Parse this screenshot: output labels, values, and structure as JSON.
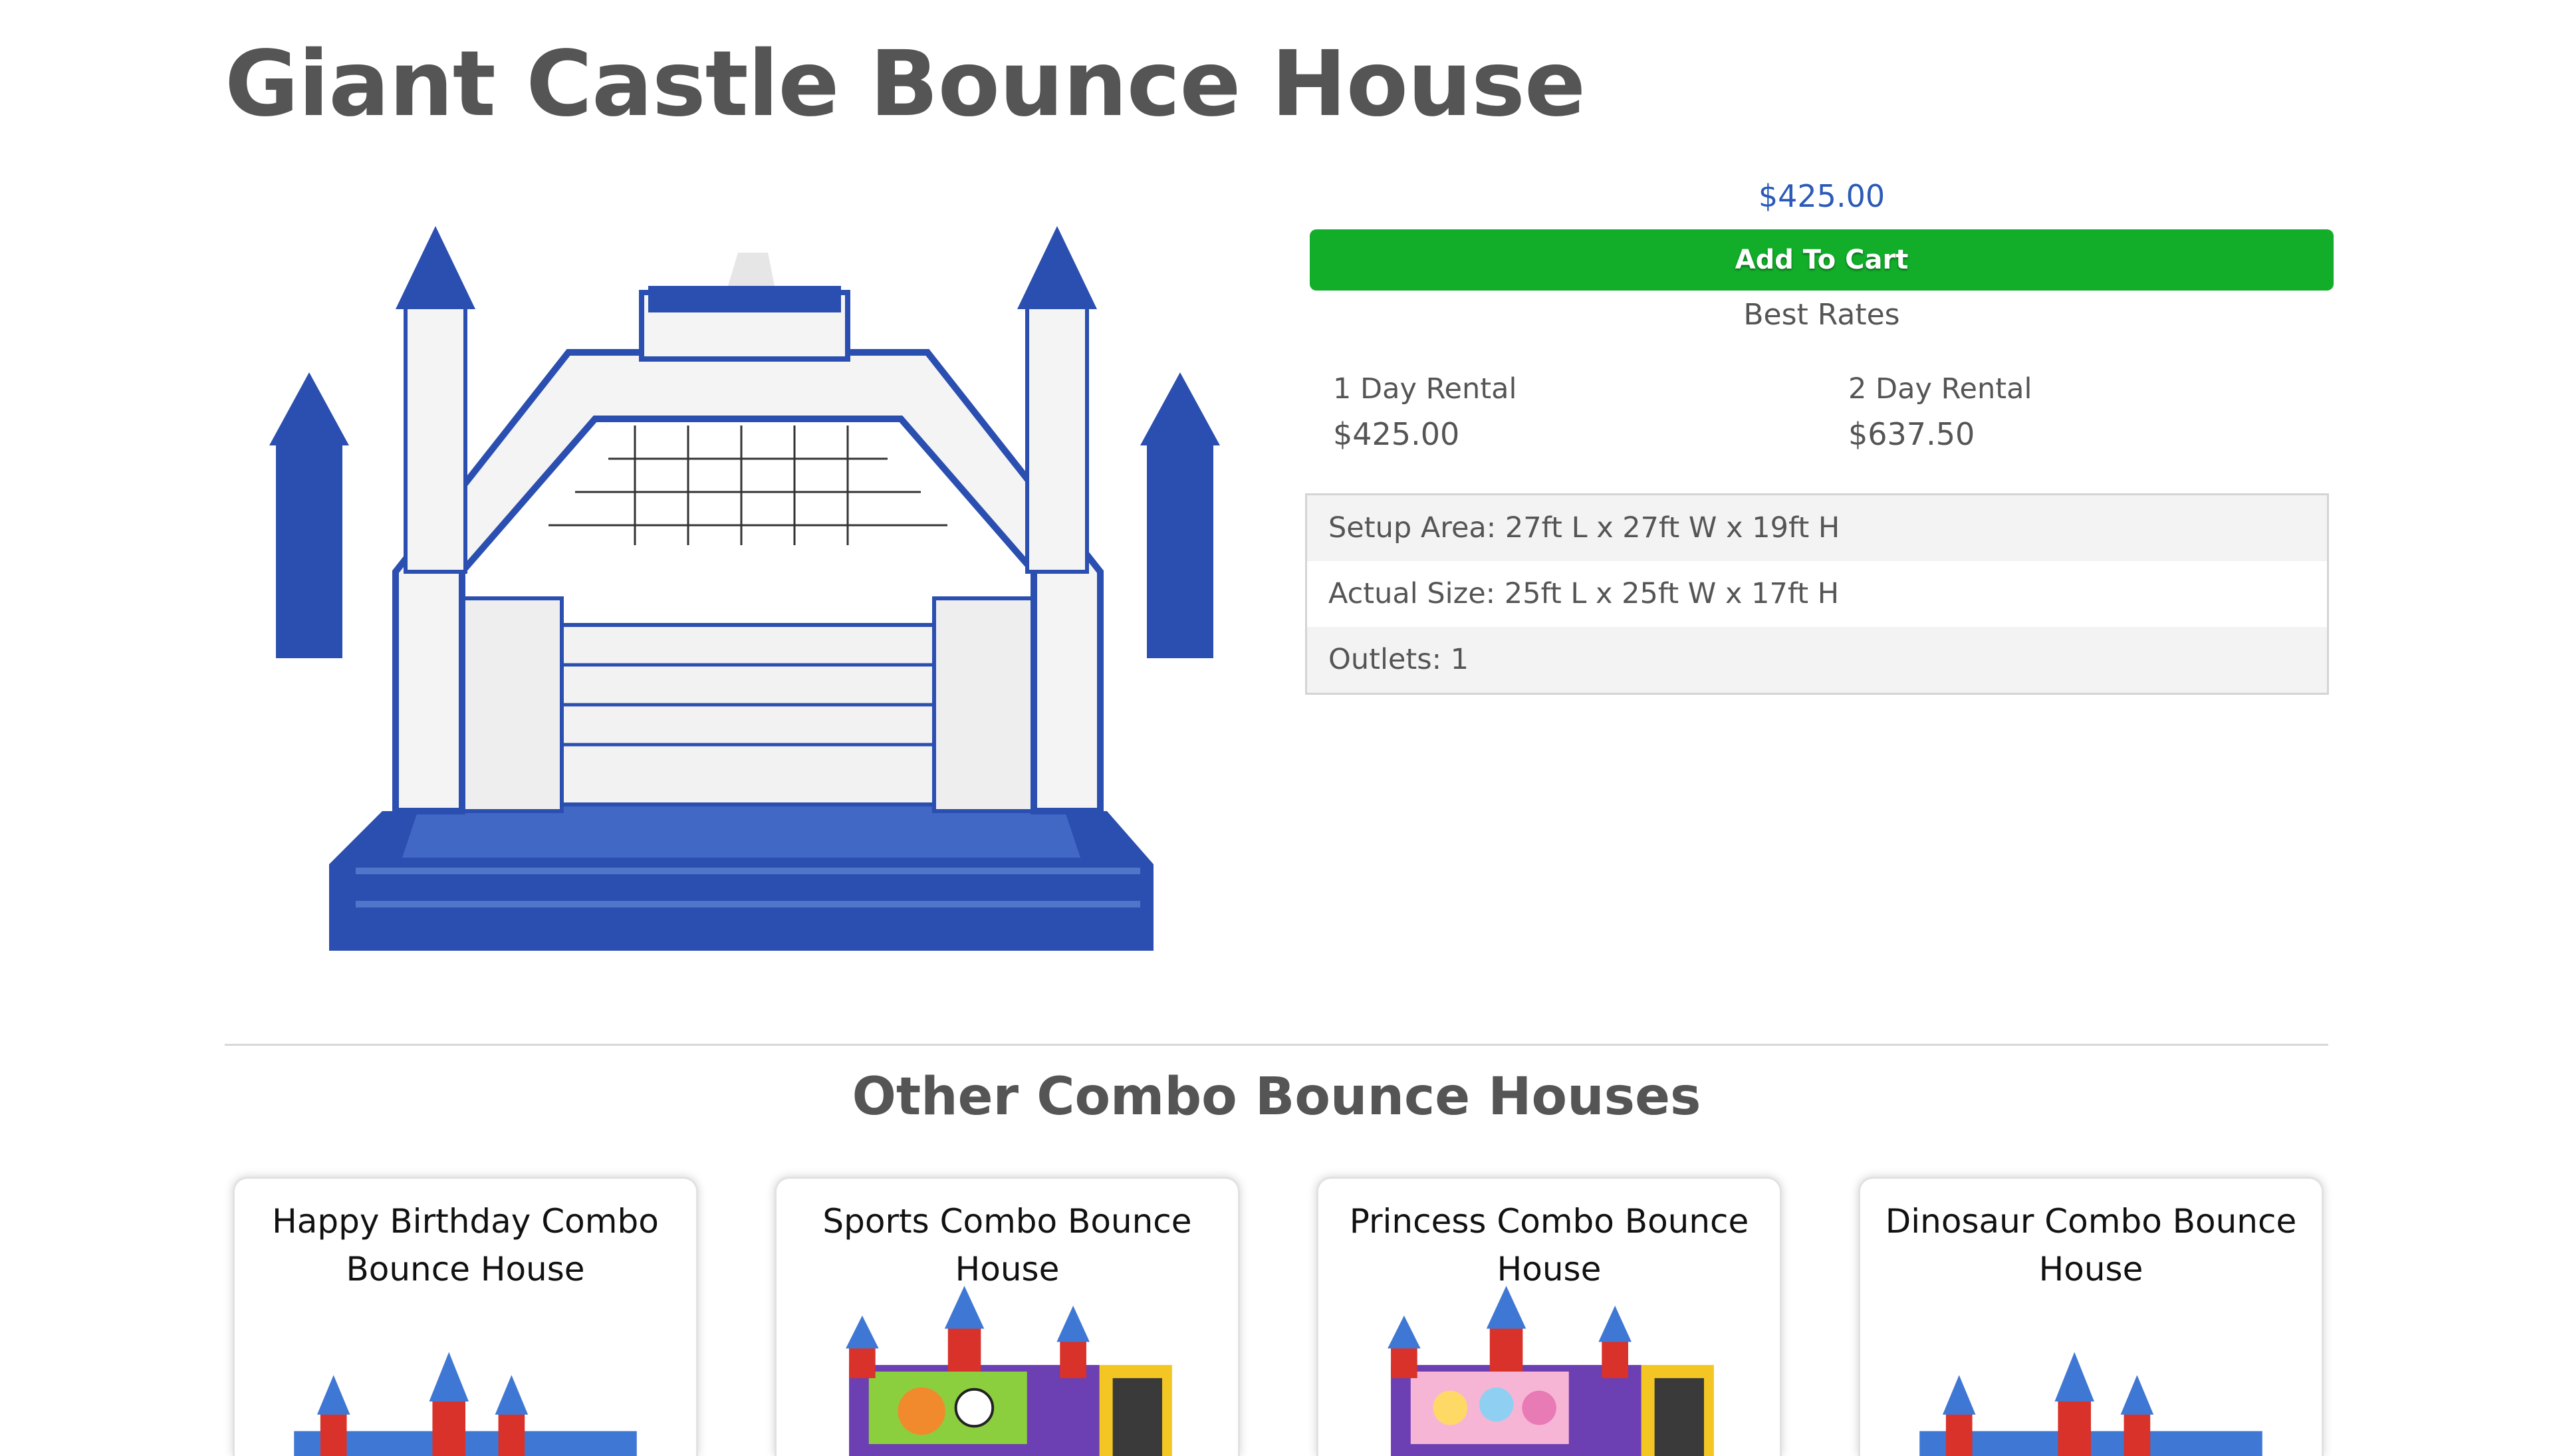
{
  "product": {
    "title": "Giant Castle Bounce House",
    "price": "$425.00",
    "add_to_cart_label": "Add To Cart",
    "best_rates_label": "Best Rates",
    "rates": [
      {
        "label": "1 Day Rental",
        "price": "$425.00"
      },
      {
        "label": "2 Day Rental",
        "price": "$637.50"
      }
    ],
    "specs": [
      "Setup Area: 27ft L x 27ft W x 19ft H",
      "Actual Size: 25ft L x 25ft W x 17ft H",
      "Outlets: 1"
    ]
  },
  "related": {
    "heading": "Other Combo Bounce Houses",
    "items": [
      {
        "title": "Happy Birthday Combo Bounce House"
      },
      {
        "title": "Sports Combo Bounce House"
      },
      {
        "title": "Princess Combo Bounce House"
      },
      {
        "title": "Dinosaur Combo Bounce House"
      }
    ]
  },
  "colors": {
    "add_to_cart_bg": "#12ae2a",
    "price_text": "#2b5ab8",
    "castle_blue": "#2a4fb0"
  },
  "icons": [
    "bounce-castle-image",
    "combo-bounce-house-image"
  ]
}
